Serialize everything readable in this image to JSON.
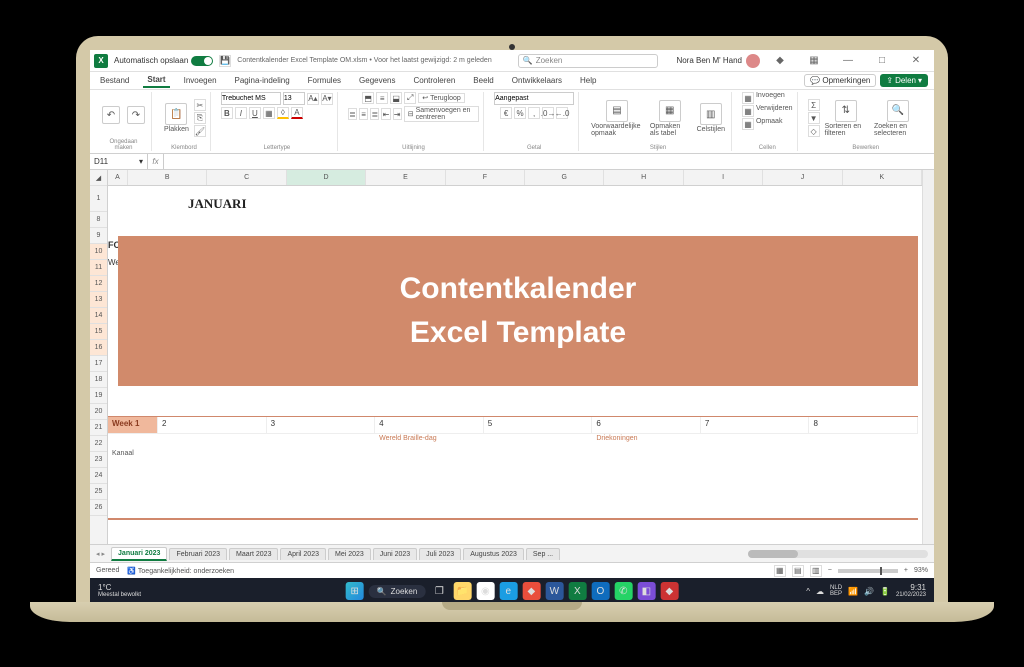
{
  "titlebar": {
    "autosave_label": "Automatisch opslaan",
    "doc_title": "Contentkalender Excel Template OM.xlsm • Voor het laatst gewijzigd: 2 m geleden",
    "search_placeholder": "Zoeken",
    "user_name": "Nora Ben M' Hand"
  },
  "ribbon_tabs": {
    "bestand": "Bestand",
    "start": "Start",
    "invoegen": "Invoegen",
    "pagina": "Pagina-indeling",
    "formules": "Formules",
    "gegevens": "Gegevens",
    "controleren": "Controleren",
    "beeld": "Beeld",
    "ontwikkelaars": "Ontwikkelaars",
    "help": "Help",
    "comments": "Opmerkingen",
    "share": "Delen"
  },
  "ribbon": {
    "undo_group": "Ongedaan maken",
    "clipboard_group": "Klembord",
    "paste": "Plakken",
    "font_group": "Lettertype",
    "font_name": "Trebuchet MS",
    "font_size": "13",
    "alignment_group": "Uitlijning",
    "wrap": "Terugloop",
    "merge": "Samenvoegen en centreren",
    "number_group": "Getal",
    "number_format": "Aangepast",
    "styles_group": "Stijlen",
    "cond_format": "Voorwaardelijke opmaak",
    "as_table": "Opmaken als tabel",
    "cell_styles": "Celstijlen",
    "cells_group": "Cellen",
    "insert": "Invoegen",
    "delete": "Verwijderen",
    "format": "Opmaak",
    "editing_group": "Bewerken",
    "sort_filter": "Sorteren en filteren",
    "find_select": "Zoeken en selecteren"
  },
  "formula_bar": {
    "name_box": "D11"
  },
  "columns": [
    "A",
    "B",
    "C",
    "D",
    "E",
    "F",
    "G",
    "H",
    "I",
    "J",
    "K"
  ],
  "sheet": {
    "month": "JANUARI",
    "fo": "FO",
    "we": "We",
    "week1": "Week 1",
    "days": [
      "2",
      "3",
      "4",
      "5",
      "6",
      "7",
      "8"
    ],
    "event_braille": "Wereld Braille-dag",
    "event_driekoningen": "Driekoningen",
    "note": "Kanaal"
  },
  "overlay": {
    "line1": "Contentkalender",
    "line2": "Excel Template"
  },
  "sheet_tabs": [
    "Januari 2023",
    "Februari 2023",
    "Maart 2023",
    "April 2023",
    "Mei 2023",
    "Juni 2023",
    "Juli 2023",
    "Augustus 2023",
    "Sep ..."
  ],
  "statusbar": {
    "ready": "Gereed",
    "access": "Toegankelijkheid: onderzoeken",
    "zoom": "93%"
  },
  "taskbar": {
    "temp": "1°C",
    "weather": "Meestal bewolkt",
    "search": "Zoeken",
    "lang": "NLD",
    "kb": "BEP",
    "time": "9:31",
    "date": "21/02/2023"
  }
}
